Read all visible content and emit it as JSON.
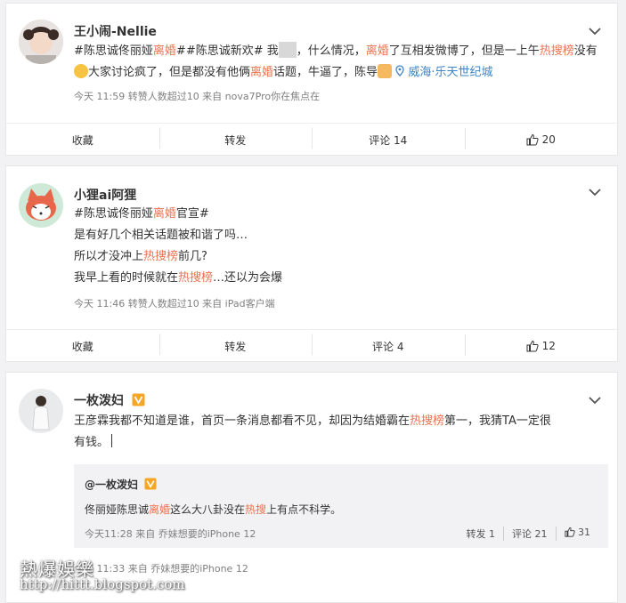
{
  "posts": [
    {
      "username": "王小闹-Nellie",
      "text": {
        "t1": "#陈思诚佟丽娅",
        "hl1": "离婚",
        "t2": "##陈思诚新欢# 我",
        "t3": "，什么情况，",
        "hl2": "离婚",
        "t4": "了互相发微博了，但是一上午",
        "hl3": "热搜榜",
        "t5": "没有",
        "t6": "大家讨论疯了，但是都没有他俩",
        "hl4": "离婚",
        "t7": "话题，牛逼了，陈导",
        "location": "威海·乐天世纪城"
      },
      "meta": "今天 11:59 转赞人数超过10  来自 nova7Pro你在焦点在",
      "actions": {
        "collect": "收藏",
        "repost": "转发",
        "comment": "评论 14",
        "like": "20"
      }
    },
    {
      "username": "小狸ai阿狸",
      "lines": {
        "l1a": "#陈思诚佟丽娅",
        "l1hl": "离婚",
        "l1b": "官宣#",
        "l2": "是有好几个相关话题被和谐了吗…",
        "l3a": "所以才没冲上",
        "l3hl": "热搜榜",
        "l3b": "前几?",
        "l4a": "我早上看的时候就在",
        "l4hl": "热搜榜",
        "l4b": "…还以为会爆"
      },
      "meta": "今天 11:46 转赞人数超过10  来自 iPad客户端",
      "actions": {
        "collect": "收藏",
        "repost": "转发",
        "comment": "评论 4",
        "like": "12"
      }
    },
    {
      "username": "一枚泼妇",
      "text": {
        "t1": "王彦霖我都不知道是谁，首页一条消息都看不见，却因为结婚霸在",
        "hl1": "热搜榜",
        "t2": "第一，我猜TA一定很",
        "t3": "有钱。"
      },
      "repost": {
        "username": "@一枚泼妇",
        "t1": "佟丽娅陈思诚",
        "hl1": "离婚",
        "t2": "这么大八卦没在",
        "hl2": "热搜",
        "t3": "上有点不科学。",
        "meta": "今天11:28 来自 乔妹想要的iPhone 12",
        "repost_label": "转发 1",
        "comment_label": "评论 21",
        "like": "31"
      },
      "meta": "今天 11:33 来自 乔妹想要的iPhone 12"
    }
  ],
  "watermark": {
    "line1": "熱爆娛樂",
    "line2": "http://hittt.blogspot.com"
  },
  "colors": {
    "highlight": "#eb7350",
    "link": "#3e84c6",
    "meta": "#808080"
  }
}
